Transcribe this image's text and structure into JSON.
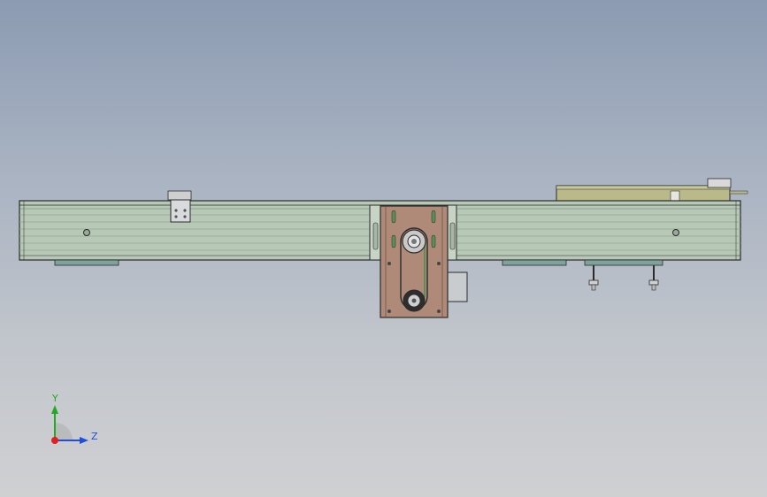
{
  "viewport": {
    "background_top": "#8c9bb2",
    "background_bottom": "#cfd0d2",
    "model_name": "",
    "view_orientation": "front"
  },
  "model": {
    "colors": {
      "rail": "#b7c8b6",
      "rail_stripe": "#8fa892",
      "outline": "#2b2b2b",
      "motor_plate": "#b08a78",
      "belt": "#5c8f55",
      "foot_pad": "#7ea39a",
      "top_cover": "#b9b98a",
      "motor_body": "#c9cccf"
    }
  },
  "triad": {
    "y_label": "Y",
    "z_label": "Z",
    "colors": {
      "y": "#22aa22",
      "z": "#1f4fd8",
      "x": "#e02020"
    }
  }
}
